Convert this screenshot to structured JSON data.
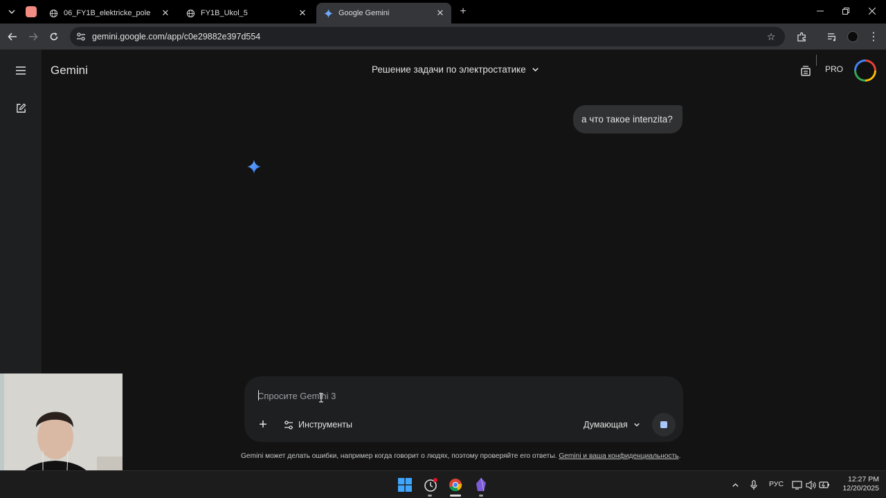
{
  "browser": {
    "tabs": [
      {
        "title": "06_FY1B_elektricke_pole",
        "active": false
      },
      {
        "title": "FY1B_Ukol_5",
        "active": false
      },
      {
        "title": "Google Gemini",
        "active": true
      }
    ],
    "url": "gemini.google.com/app/c0e29882e397d554"
  },
  "app": {
    "brand": "Gemini",
    "conversation_title": "Решение задачи по электростатике",
    "plan_badge": "PRO"
  },
  "chat": {
    "user_message": "а что такое intenzita?"
  },
  "composer": {
    "placeholder": "Спросите Gemini 3",
    "tools_label": "Инструменты",
    "mode_label": "Думающая"
  },
  "footer": {
    "disclaimer_text": "Gemini может делать ошибки, например когда говорит о людях, поэтому проверяйте его ответы.",
    "disclaimer_link": "Gemini и ваша конфиденциальность",
    "disclaimer_end": "."
  },
  "taskbar": {
    "language": "РУС",
    "time": "12:27 PM",
    "date": "12/20/2025"
  },
  "colors": {
    "background": "#131314",
    "sidebar": "#1e1f20",
    "accent_blue": "#4285f4",
    "stop_square": "#a8c7fa"
  }
}
